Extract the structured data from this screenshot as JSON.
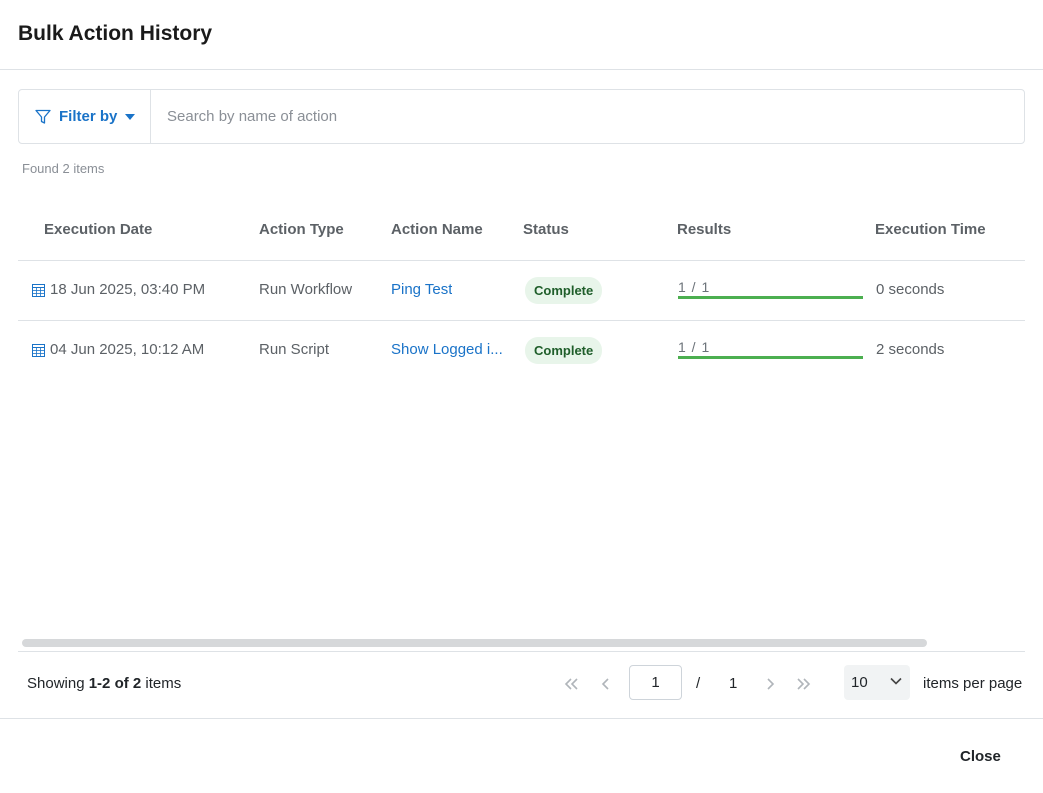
{
  "dialog": {
    "title": "Bulk Action History"
  },
  "filter": {
    "label": "Filter by",
    "search_placeholder": "Search by name of action",
    "search_value": ""
  },
  "found_text": "Found 2 items",
  "columns": [
    "Execution Date",
    "Action Type",
    "Action Name",
    "Status",
    "Results",
    "Execution Time"
  ],
  "rows": [
    {
      "date": "18 Jun 2025, 03:40 PM",
      "type": "Run Workflow",
      "name": "Ping Test",
      "status": "Complete",
      "results": "1 / 1",
      "progress": 1.0,
      "time": "0 seconds"
    },
    {
      "date": "04 Jun 2025, 10:12 AM",
      "type": "Run Script",
      "name": "Show Logged i...",
      "status": "Complete",
      "results": "1 / 1",
      "progress": 1.0,
      "time": "2 seconds"
    }
  ],
  "pagination": {
    "showing_prefix": "Showing",
    "showing_range": "1-2 of 2",
    "showing_suffix": "items",
    "current_page": "1",
    "slash": "/",
    "total_pages": "1",
    "per_page": "10",
    "per_page_label": "items per page"
  },
  "footer": {
    "close_label": "Close"
  },
  "colors": {
    "accent": "#1a73c8",
    "success": "#4caf50",
    "badge_bg": "#e8f5ea",
    "badge_text": "#1f5e2a"
  },
  "icons": [
    "filter-icon",
    "caret-down-icon",
    "calendar-icon",
    "first-page-icon",
    "prev-page-icon",
    "next-page-icon",
    "last-page-icon",
    "chevron-down-icon"
  ]
}
